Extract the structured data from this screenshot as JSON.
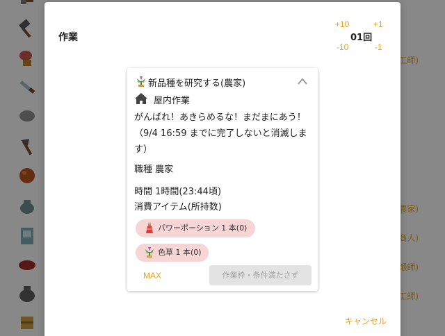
{
  "dialog": {
    "title": "作業",
    "steps": {
      "plus10": "+10",
      "plus1": "+1",
      "minus10": "-10",
      "minus1": "-1"
    },
    "count": "01回",
    "cancel_label": "キャンセル"
  },
  "card": {
    "title": "新品種を研究する(農家)",
    "location": "屋内作業",
    "message": "がんばれ！あきらめるな！まだまにあう！（9/4 16:59 までに完了しないと消滅します）",
    "job": "職種 農家",
    "time": "時間 1時間(23:44頃)",
    "consume_label": "消費アイテム(所持数)",
    "items": [
      {
        "label": "パワーポーション 1 本(0)",
        "icon": "potion-icon"
      },
      {
        "label": "色草 1 本(0)",
        "icon": "herb-icon"
      }
    ],
    "max_label": "MAX",
    "submit_label": "作業枠・条件満たさず"
  },
  "background": {
    "right_labels": [
      "工師)",
      "農家)",
      "商人)",
      "鍛師)",
      "工師)"
    ]
  },
  "colors": {
    "accent": "#e6a020",
    "pill": "#f7d5d5",
    "disabled": "#e3e3e3"
  }
}
